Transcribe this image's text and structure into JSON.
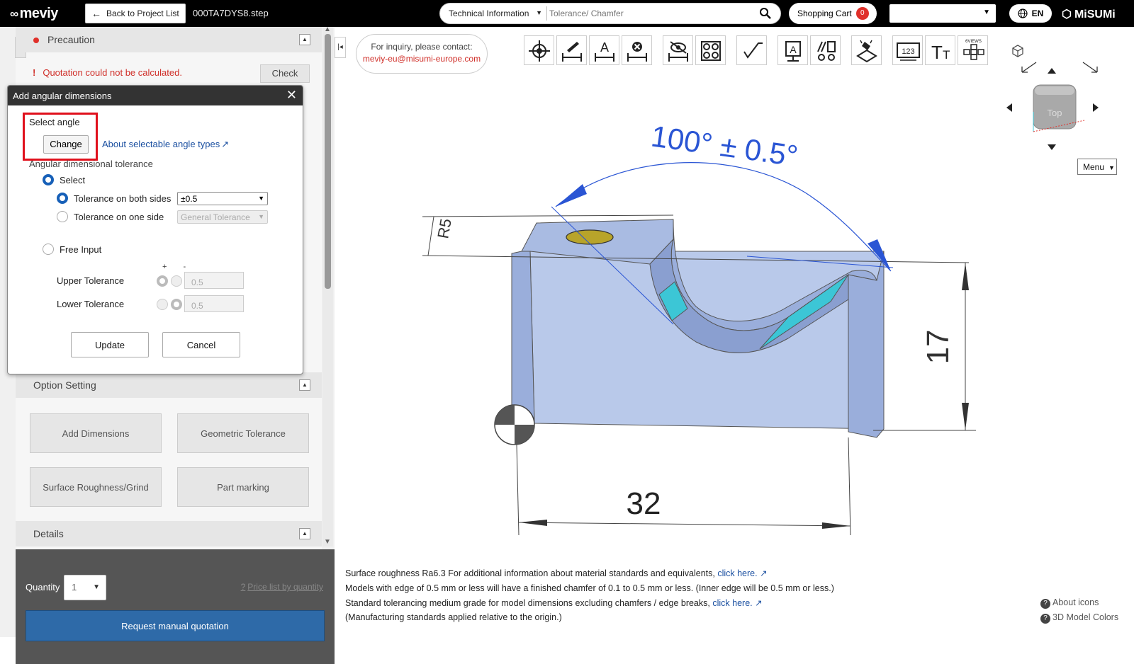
{
  "header": {
    "logo": "meviy",
    "back_label": "Back to Project List",
    "filename": "000TA7DYS8.step",
    "search_category": "Technical Information",
    "search_placeholder": "Tolerance/ Chamfer",
    "cart_label": "Shopping Cart",
    "cart_count": "0",
    "lang": "EN",
    "brand": "MiSUMi"
  },
  "left_panel": {
    "precaution_title": "Precaution",
    "quotation_error": "Quotation could not be calculated.",
    "check_label": "Check",
    "option_setting_title": "Option Setting",
    "option_buttons": [
      "Add Dimensions",
      "Geometric Tolerance",
      "Surface Roughness/Grind",
      "Part marking"
    ],
    "details_title": "Details",
    "quantity_label": "Quantity",
    "quantity_value": "1",
    "price_list_link": "Price list by quantity",
    "manual_quote_label": "Request manual quotation"
  },
  "dialog": {
    "title": "Add angular dimensions",
    "select_angle_label": "Select angle",
    "change_label": "Change",
    "about_link": "About selectable angle types",
    "tolerance_section_label": "Angular dimensional tolerance",
    "select_label": "Select",
    "both_sides_label": "Tolerance on both sides",
    "both_sides_value": "±0.5",
    "one_side_label": "Tolerance on one side",
    "one_side_value": "General Tolerance",
    "free_input_label": "Free Input",
    "plus_minus": "+ -",
    "upper_label": "Upper Tolerance",
    "upper_value": "0.5",
    "lower_label": "Lower Tolerance",
    "lower_value": "0.5",
    "update_label": "Update",
    "cancel_label": "Cancel"
  },
  "viewer": {
    "inquiry_line1": "For inquiry, please contact:",
    "inquiry_email": "meviy-eu@misumi-europe.com",
    "toolbar_icons": [
      "origin-icon",
      "edit-dimension-icon",
      "text-dimension-icon",
      "delete-dimension-icon",
      "hide-dimension-icon",
      "hole-pattern-icon",
      "surface-roughness-icon",
      "annotation-icon",
      "geometric-tolerance-icon",
      "part-marking-icon",
      "numbered-view-icon",
      "font-size-icon",
      "six-views-icon"
    ],
    "six_views_label": "6VIEWS",
    "angle_dimension": "100° ± 0.5°",
    "dim_height": "17",
    "dim_width": "32",
    "dim_small": "R5",
    "view_cube_label": "Top",
    "menu_label": "Menu",
    "colors": {
      "part_face": "#b9c9ea",
      "part_face_dark": "#9aaedb",
      "hole": "#b8a42a",
      "highlight": "#3cc6d6",
      "dimension_blue": "#2a55d4"
    }
  },
  "notes": {
    "line1_text": "Surface roughness Ra6.3    For additional information about material standards and equivalents,",
    "line1_link": "click here.",
    "line2_text": "Models with edge of 0.5 mm or less will have a finished chamfer of 0.1 to 0.5 mm or less. (Inner edge will be 0.5 mm or less.)",
    "line3_text": "Standard tolerancing medium grade for model dimensions excluding chamfers / edge breaks,",
    "line3_link": "click here.",
    "line4_text": "(Manufacturing standards applied relative to the origin.)"
  },
  "footer_links": {
    "about_icons": "About icons",
    "model_colors": "3D Model Colors"
  }
}
